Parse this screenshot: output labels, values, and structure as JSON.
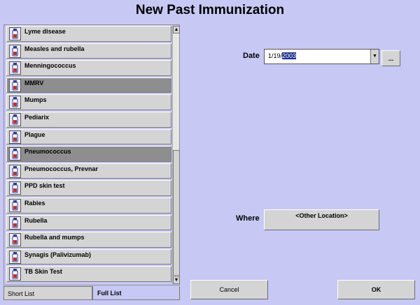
{
  "title": "New Past Immunization",
  "vaccines": [
    {
      "label": "Lyme disease",
      "selected": false
    },
    {
      "label": "Measles and rubella",
      "selected": false
    },
    {
      "label": "Menningococcus",
      "selected": false
    },
    {
      "label": "MMRV",
      "selected": true
    },
    {
      "label": "Mumps",
      "selected": false
    },
    {
      "label": "Pediarix",
      "selected": false
    },
    {
      "label": "Plague",
      "selected": false
    },
    {
      "label": "Pneumococcus",
      "selected": true
    },
    {
      "label": "Pneumococcus, Prevnar",
      "selected": false
    },
    {
      "label": "PPD skin test",
      "selected": false
    },
    {
      "label": "Rabies",
      "selected": false
    },
    {
      "label": "Rubella",
      "selected": false
    },
    {
      "label": "Rubella and mumps",
      "selected": false
    },
    {
      "label": "Synagis (Palivizumab)",
      "selected": false
    },
    {
      "label": "TB Skin Test",
      "selected": false
    }
  ],
  "tabs": {
    "short": "Short List",
    "full": "Full List"
  },
  "date": {
    "label": "Date",
    "value_prefix": "1/19/",
    "value_selected": "2003",
    "button": "..."
  },
  "where": {
    "label": "Where",
    "button": "<Other Location>"
  },
  "buttons": {
    "cancel": "Cancel",
    "ok": "OK"
  },
  "colors": {
    "background": "#c8c8f5",
    "selected_item": "#8e8e8e",
    "button": "#d4d4d4",
    "text_selection": "#1a2e8c"
  },
  "icons": {
    "vaccine_item": "syringe-vial-icon",
    "scroll_up": "arrow-up-icon",
    "scroll_down": "arrow-down-icon",
    "date_dropdown": "chevron-down-icon"
  }
}
